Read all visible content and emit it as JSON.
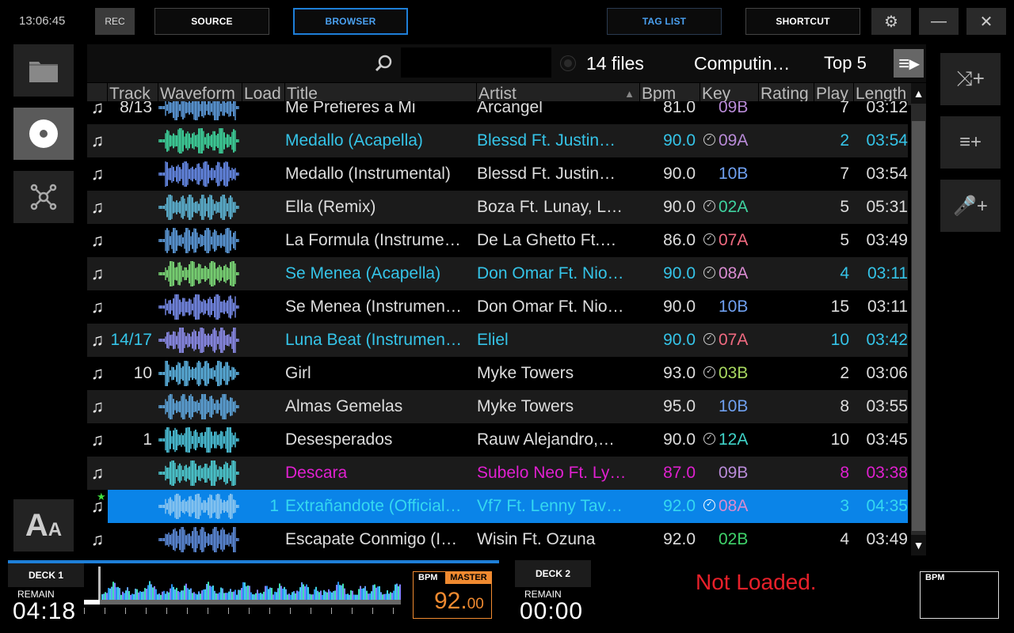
{
  "topbar": {
    "time": "13:06:45",
    "rec": "REC",
    "source": "SOURCE",
    "browser": "BROWSER",
    "taglist": "TAG LIST",
    "shortcut": "SHORTCUT"
  },
  "toolbar": {
    "files": "14 files",
    "playlist": "Computin…",
    "top": "Top 5"
  },
  "columns": {
    "track": "Track",
    "waveform": "Waveform",
    "load": "Load",
    "title": "Title",
    "artist": "Artist",
    "bpm": "Bpm",
    "key": "Key",
    "rating": "Rating",
    "play": "Play",
    "length": "Length"
  },
  "rows": [
    {
      "track": "8/13",
      "title": "Me Prefieres a Mi",
      "artist": "Arcangel",
      "bpm": "81.0",
      "check": "",
      "key": "09B",
      "plays": "7",
      "length": "03:12",
      "tcolor": "#ddd",
      "kcolor": "#b98bd8",
      "bg": "#000",
      "wf": "#5f9ee0"
    },
    {
      "track": "",
      "title": "Medallo (Acapella)",
      "artist": "Blessd Ft. Justin…",
      "bpm": "90.0",
      "check": "✓",
      "key": "09A",
      "plays": "2",
      "length": "03:54",
      "tcolor": "#35c4e8",
      "kcolor": "#b98bd8",
      "bg": "#1b1b1b",
      "wf": "#3fd8a0"
    },
    {
      "track": "",
      "title": "Medallo (Instrumental)",
      "artist": "Blessd Ft. Justin…",
      "bpm": "90.0",
      "check": "",
      "key": "10B",
      "plays": "7",
      "length": "03:54",
      "tcolor": "#ddd",
      "kcolor": "#6fa0f0",
      "bg": "#000",
      "wf": "#6a8ff0"
    },
    {
      "track": "",
      "title": "Ella (Remix)",
      "artist": "Boza Ft. Lunay, L…",
      "bpm": "90.0",
      "check": "✓",
      "key": "02A",
      "plays": "5",
      "length": "05:31",
      "tcolor": "#ddd",
      "kcolor": "#3fd3a0",
      "bg": "#1b1b1b",
      "wf": "#5fb8d8"
    },
    {
      "track": "",
      "title": "La Formula (Instrume…",
      "artist": "De La Ghetto Ft.…",
      "bpm": "86.0",
      "check": "✓",
      "key": "07A",
      "plays": "5",
      "length": "03:49",
      "tcolor": "#ddd",
      "kcolor": "#f06a80",
      "bg": "#000",
      "wf": "#5f9ee0"
    },
    {
      "track": "",
      "title": "Se Menea (Acapella)",
      "artist": "Don Omar Ft. Nio…",
      "bpm": "90.0",
      "check": "✓",
      "key": "08A",
      "plays": "4",
      "length": "03:11",
      "tcolor": "#35c4e8",
      "kcolor": "#d88bd0",
      "bg": "#1b1b1b",
      "wf": "#7fe07a"
    },
    {
      "track": "",
      "title": "Se Menea (Instrumen…",
      "artist": "Don Omar Ft. Nio…",
      "bpm": "90.0",
      "check": "",
      "key": "10B",
      "plays": "15",
      "length": "03:11",
      "tcolor": "#ddd",
      "kcolor": "#6fa0f0",
      "bg": "#000",
      "wf": "#7a8ff0"
    },
    {
      "track": "14/17",
      "title": "Luna Beat (Instrumen…",
      "artist": "Eliel",
      "bpm": "90.0",
      "check": "✓",
      "key": "07A",
      "plays": "10",
      "length": "03:42",
      "tcolor": "#35c4e8",
      "kcolor": "#f06a80",
      "bg": "#1b1b1b",
      "wf": "#8f8ff0"
    },
    {
      "track": "10",
      "title": "Girl",
      "artist": "Myke Towers",
      "bpm": "93.0",
      "check": "✓",
      "key": "03B",
      "plays": "2",
      "length": "03:06",
      "tcolor": "#ddd",
      "kcolor": "#a8d860",
      "bg": "#000",
      "wf": "#5fb8e8"
    },
    {
      "track": "",
      "title": "Almas Gemelas",
      "artist": "Myke Towers",
      "bpm": "95.0",
      "check": "",
      "key": "10B",
      "plays": "8",
      "length": "03:55",
      "tcolor": "#ddd",
      "kcolor": "#6fa0f0",
      "bg": "#1b1b1b",
      "wf": "#5fa8e0"
    },
    {
      "track": "1",
      "title": "Desesperados",
      "artist": "Rauw Alejandro,…",
      "bpm": "90.0",
      "check": "✓",
      "key": "12A",
      "plays": "10",
      "length": "03:45",
      "tcolor": "#ddd",
      "kcolor": "#3fd3c8",
      "bg": "#000",
      "wf": "#4fc8e0"
    },
    {
      "track": "",
      "title": "Descara",
      "artist": "Subelo Neo Ft. Ly…",
      "bpm": "87.0",
      "check": "",
      "key": "09B",
      "plays": "8",
      "length": "03:38",
      "tcolor": "#e020d0",
      "kcolor": "#b98bd8",
      "bg": "#1b1b1b",
      "wf": "#4fd0d8"
    },
    {
      "track": "",
      "load": "1",
      "title": "Extrañandote (Official…",
      "artist": "Vf7 Ft. Lenny Tav…",
      "bpm": "92.0",
      "check": "✓",
      "key": "08A",
      "plays": "3",
      "length": "04:35",
      "tcolor": "#35d8f0",
      "kcolor": "#d88bd0",
      "bg": "#0a84e8",
      "wf": "#8fc8f0"
    },
    {
      "track": "",
      "title": "Escapate Conmigo (I…",
      "artist": "Wisin Ft. Ozuna",
      "bpm": "92.0",
      "check": "",
      "key": "02B",
      "plays": "4",
      "length": "03:49",
      "tcolor": "#ddd",
      "kcolor": "#3fd36a",
      "bg": "#000",
      "wf": "#5f8fe0"
    }
  ],
  "deck1": {
    "label": "DECK 1",
    "remain_label": "REMAIN",
    "remain": "04:18",
    "bpm_label": "BPM",
    "master": "MASTER",
    "bpm_int": "92.",
    "bpm_dec": "00",
    "progress": 0.05
  },
  "deck2": {
    "label": "DECK 2",
    "remain_label": "REMAIN",
    "remain": "00:00",
    "status": "Not Loaded.",
    "bpm_label": "BPM"
  },
  "colors": {
    "accent": "#1e7fd8",
    "selected": "#0a84e8",
    "not_loaded": "#e8202a",
    "bpm_master": "#f08a30"
  }
}
